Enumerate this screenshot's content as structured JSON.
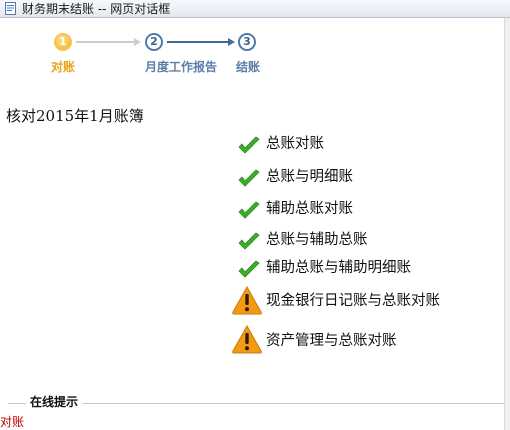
{
  "window": {
    "title": "财务期末结账 -- 网页对话框"
  },
  "steps": [
    {
      "number": "1",
      "label": "对账",
      "state": "active"
    },
    {
      "number": "2",
      "label": "月度工作报告",
      "state": "pending"
    },
    {
      "number": "3",
      "label": "结账",
      "state": "pending"
    }
  ],
  "heading": "核对2015年1月账簿",
  "checks": [
    {
      "label": "总账对账",
      "status": "ok",
      "icon": "checkmark-icon"
    },
    {
      "label": "总账与明细账",
      "status": "ok",
      "icon": "checkmark-icon"
    },
    {
      "label": "辅助总账对账",
      "status": "ok",
      "icon": "checkmark-icon"
    },
    {
      "label": "总账与辅助总账",
      "status": "ok",
      "icon": "checkmark-icon"
    },
    {
      "label": "辅助总账与辅助明细账",
      "status": "ok",
      "icon": "checkmark-icon"
    },
    {
      "label": "现金银行日记账与总账对账",
      "status": "warning",
      "icon": "warning-icon"
    },
    {
      "label": "资产管理与总账对账",
      "status": "warning",
      "icon": "warning-icon"
    }
  ],
  "tips": {
    "legend": "在线提示",
    "text": "对账"
  },
  "colors": {
    "active_step": "#f0b323",
    "pending_step": "#4f7aa8",
    "check_green": "#3cae2c",
    "warning_orange": "#f39a12",
    "tip_red": "#c00000"
  }
}
